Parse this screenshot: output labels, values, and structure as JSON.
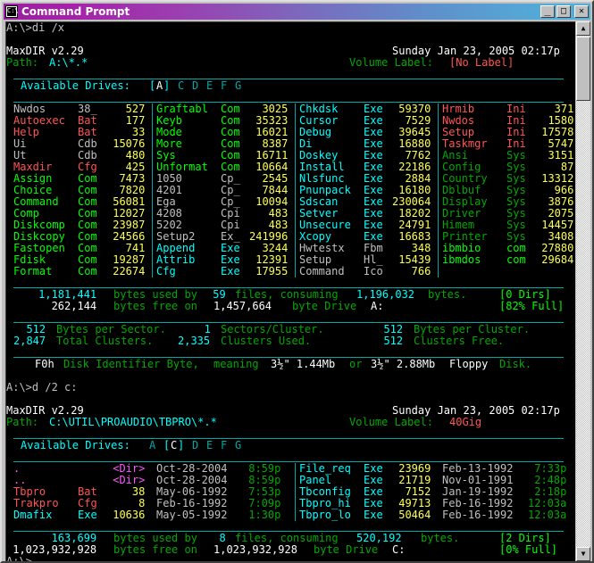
{
  "window": {
    "title": "Command Prompt",
    "icon": "console-window-icon",
    "buttons": {
      "minimize": "_",
      "maximize": "□",
      "close": "✕"
    }
  },
  "scrollbar": {
    "up_arrow": "▲",
    "down_arrow": "▼"
  },
  "console": {
    "prompt1": "A:\\>di /x",
    "prompt2": "A:\\>d /2 c:",
    "prompt3": "A:\\>_",
    "listing1": {
      "app_title": "MaxDIR v2.29",
      "datetime": "Sunday Jan 23, 2005 02:17p",
      "path_label": "Path:",
      "path_value": "A:\\*.*",
      "volume_label": "Volume Label:",
      "volume_value": "[No Label]",
      "drives_label": "Available Drives:",
      "drives_value": "[A] C D E F G",
      "columns": [
        [
          {
            "name": "Nwdos",
            "ext": "38_",
            "size": "527",
            "cname": "c-white",
            "cext": "c-white"
          },
          {
            "name": "Autoexec",
            "ext": "Bat",
            "size": "177",
            "cname": "c-bred",
            "cext": "c-bred"
          },
          {
            "name": "Help",
            "ext": "Bat",
            "size": "33",
            "cname": "c-bred",
            "cext": "c-bred"
          },
          {
            "name": "Ui",
            "ext": "Cdb",
            "size": "15076",
            "cname": "c-white",
            "cext": "c-white"
          },
          {
            "name": "Ut",
            "ext": "Cdb",
            "size": "480",
            "cname": "c-white",
            "cext": "c-white"
          },
          {
            "name": "Maxdir",
            "ext": "Cfg",
            "size": "425",
            "cname": "c-bred",
            "cext": "c-bred"
          },
          {
            "name": "Assign",
            "ext": "Com",
            "size": "7473",
            "cname": "c-bgreen",
            "cext": "c-bgreen"
          },
          {
            "name": "Choice",
            "ext": "Com",
            "size": "7820",
            "cname": "c-bgreen",
            "cext": "c-bgreen"
          },
          {
            "name": "Command",
            "ext": "Com",
            "size": "56081",
            "cname": "c-bgreen",
            "cext": "c-bgreen"
          },
          {
            "name": "Comp",
            "ext": "Com",
            "size": "12027",
            "cname": "c-bgreen",
            "cext": "c-bgreen"
          },
          {
            "name": "Diskcomp",
            "ext": "Com",
            "size": "23987",
            "cname": "c-bgreen",
            "cext": "c-bgreen"
          },
          {
            "name": "Diskcopy",
            "ext": "Com",
            "size": "24566",
            "cname": "c-bgreen",
            "cext": "c-bgreen"
          },
          {
            "name": "Fastopen",
            "ext": "Com",
            "size": "741",
            "cname": "c-bgreen",
            "cext": "c-bgreen"
          },
          {
            "name": "Fdisk",
            "ext": "Com",
            "size": "19287",
            "cname": "c-bgreen",
            "cext": "c-bgreen"
          },
          {
            "name": "Format",
            "ext": "Com",
            "size": "22674",
            "cname": "c-bgreen",
            "cext": "c-bgreen"
          }
        ],
        [
          {
            "name": "Graftabl",
            "ext": "Com",
            "size": "3025",
            "cname": "c-bgreen",
            "cext": "c-bgreen"
          },
          {
            "name": "Keyb",
            "ext": "Com",
            "size": "35323",
            "cname": "c-bgreen",
            "cext": "c-bgreen"
          },
          {
            "name": "Mode",
            "ext": "Com",
            "size": "16021",
            "cname": "c-bgreen",
            "cext": "c-bgreen"
          },
          {
            "name": "More",
            "ext": "Com",
            "size": "8387",
            "cname": "c-bgreen",
            "cext": "c-bgreen"
          },
          {
            "name": "Sys",
            "ext": "Com",
            "size": "16711",
            "cname": "c-bgreen",
            "cext": "c-bgreen"
          },
          {
            "name": "Unformat",
            "ext": "Com",
            "size": "10664",
            "cname": "c-bgreen",
            "cext": "c-bgreen"
          },
          {
            "name": "1050",
            "ext": "Cp_",
            "size": "2545",
            "cname": "c-white",
            "cext": "c-white"
          },
          {
            "name": "4201",
            "ext": "Cp_",
            "size": "7844",
            "cname": "c-white",
            "cext": "c-white"
          },
          {
            "name": "Ega",
            "ext": "Cp_",
            "size": "10094",
            "cname": "c-white",
            "cext": "c-white"
          },
          {
            "name": "4208",
            "ext": "Cpi",
            "size": "483",
            "cname": "c-white",
            "cext": "c-white"
          },
          {
            "name": "5202",
            "ext": "Cpi",
            "size": "483",
            "cname": "c-white",
            "cext": "c-white"
          },
          {
            "name": "Setup2",
            "ext": "Ex_",
            "size": "241996",
            "cname": "c-white",
            "cext": "c-white"
          },
          {
            "name": "Append",
            "ext": "Exe",
            "size": "3244",
            "cname": "c-bcyan",
            "cext": "c-bcyan"
          },
          {
            "name": "Attrib",
            "ext": "Exe",
            "size": "12391",
            "cname": "c-bcyan",
            "cext": "c-bcyan"
          },
          {
            "name": "Cfg",
            "ext": "Exe",
            "size": "17955",
            "cname": "c-bcyan",
            "cext": "c-bcyan"
          }
        ],
        [
          {
            "name": "Chkdsk",
            "ext": "Exe",
            "size": "59370",
            "cname": "c-bcyan",
            "cext": "c-bcyan"
          },
          {
            "name": "Cursor",
            "ext": "Exe",
            "size": "7529",
            "cname": "c-bcyan",
            "cext": "c-bcyan"
          },
          {
            "name": "Debug",
            "ext": "Exe",
            "size": "39645",
            "cname": "c-bcyan",
            "cext": "c-bcyan"
          },
          {
            "name": "Di",
            "ext": "Exe",
            "size": "16880",
            "cname": "c-bcyan",
            "cext": "c-bcyan"
          },
          {
            "name": "Doskey",
            "ext": "Exe",
            "size": "7762",
            "cname": "c-bcyan",
            "cext": "c-bcyan"
          },
          {
            "name": "Install",
            "ext": "Exe",
            "size": "22186",
            "cname": "c-bcyan",
            "cext": "c-bcyan"
          },
          {
            "name": "Nlsfunc",
            "ext": "Exe",
            "size": "2884",
            "cname": "c-bcyan",
            "cext": "c-bcyan"
          },
          {
            "name": "Pnunpack",
            "ext": "Exe",
            "size": "16180",
            "cname": "c-bcyan",
            "cext": "c-bcyan"
          },
          {
            "name": "Sdscan",
            "ext": "Exe",
            "size": "230064",
            "cname": "c-bcyan",
            "cext": "c-bcyan"
          },
          {
            "name": "Setver",
            "ext": "Exe",
            "size": "18202",
            "cname": "c-bcyan",
            "cext": "c-bcyan"
          },
          {
            "name": "Unsecure",
            "ext": "Exe",
            "size": "24791",
            "cname": "c-bcyan",
            "cext": "c-bcyan"
          },
          {
            "name": "Xcopy",
            "ext": "Exe",
            "size": "16683",
            "cname": "c-bcyan",
            "cext": "c-bcyan"
          },
          {
            "name": "Hwtestx",
            "ext": "Fbm",
            "size": "348",
            "cname": "c-white",
            "cext": "c-white"
          },
          {
            "name": "Setup",
            "ext": "Hl_",
            "size": "15439",
            "cname": "c-white",
            "cext": "c-white"
          },
          {
            "name": "Command",
            "ext": "Ico",
            "size": "766",
            "cname": "c-white",
            "cext": "c-white"
          }
        ],
        [
          {
            "name": "Hrmib",
            "ext": "Ini",
            "size": "371",
            "cname": "c-bred",
            "cext": "c-bred"
          },
          {
            "name": "Nwdos",
            "ext": "Ini",
            "size": "1580",
            "cname": "c-bred",
            "cext": "c-bred"
          },
          {
            "name": "Setup",
            "ext": "Ini",
            "size": "17578",
            "cname": "c-bred",
            "cext": "c-bred"
          },
          {
            "name": "Taskmgr",
            "ext": "Ini",
            "size": "5747",
            "cname": "c-bred",
            "cext": "c-bred"
          },
          {
            "name": "Ansi",
            "ext": "Sys",
            "size": "3151",
            "cname": "c-green",
            "cext": "c-green"
          },
          {
            "name": "Config",
            "ext": "Sys",
            "size": "87",
            "cname": "c-green",
            "cext": "c-green"
          },
          {
            "name": "Country",
            "ext": "Sys",
            "size": "13312",
            "cname": "c-green",
            "cext": "c-green"
          },
          {
            "name": "Dblbuf",
            "ext": "Sys",
            "size": "966",
            "cname": "c-green",
            "cext": "c-green"
          },
          {
            "name": "Display",
            "ext": "Sys",
            "size": "3876",
            "cname": "c-green",
            "cext": "c-green"
          },
          {
            "name": "Driver",
            "ext": "Sys",
            "size": "2075",
            "cname": "c-green",
            "cext": "c-green"
          },
          {
            "name": "Himem",
            "ext": "Sys",
            "size": "14457",
            "cname": "c-green",
            "cext": "c-green"
          },
          {
            "name": "Printer",
            "ext": "Sys",
            "size": "3408",
            "cname": "c-green",
            "cext": "c-green"
          },
          {
            "name": "ibmbio",
            "ext": "com",
            "size": "27880",
            "cname": "c-bgreen",
            "cext": "c-bgreen"
          },
          {
            "name": "ibmdos",
            "ext": "com",
            "size": "29684",
            "cname": "c-bgreen",
            "cext": "c-bgreen"
          }
        ]
      ],
      "summary": {
        "bytes_used": "1,181,441",
        "bytes_used_label": "bytes used by",
        "file_count": "59",
        "files_label": "files, consuming",
        "consumed": "1,196,032",
        "bytes_label": "bytes.",
        "dirs": "[0 Dirs]",
        "bytes_free": "262,144",
        "free_label": "bytes free on",
        "total_bytes": "1,457,664",
        "drive_label": "byte Drive",
        "drive": "A:",
        "full": "[82% Full]"
      },
      "geometry": {
        "bytes_per_sector": "512",
        "bytes_per_sector_label": "Bytes per Sector.",
        "sectors_per_cluster": "1",
        "sectors_per_cluster_label": "Sectors/Cluster.",
        "bytes_per_cluster": "512",
        "bytes_per_cluster_label": "Bytes per Cluster.",
        "total_clusters": "2,847",
        "total_clusters_label": "Total Clusters.",
        "clusters_used": "2,335",
        "clusters_used_label": "Clusters Used.",
        "clusters_free": "512",
        "clusters_free_label": "Clusters Free."
      },
      "media": {
        "id_byte": "F0h",
        "id_label": "Disk Identifier Byte,",
        "meaning_label": "meaning",
        "size1": "3½\" 1.44Mb",
        "or_label": "or",
        "size2": "3½\" 2.88Mb",
        "media_label": "Floppy",
        "disk_label": "Disk."
      }
    },
    "listing2": {
      "app_title": "MaxDIR v2.29",
      "datetime": "Sunday Jan 23, 2005 02:17p",
      "path_label": "Path:",
      "path_value": "C:\\UTIL\\PROAUDIO\\TBPRO\\*.*",
      "volume_label": "Volume Label:",
      "volume_value": "40Gig",
      "drives_label": "Available Drives:",
      "drives_value": "A [C] D E F G",
      "columns": [
        [
          {
            "name": ".",
            "ext": "",
            "size": "<Dir>",
            "date": "Oct-28-2004",
            "time": "8:59p",
            "cname": "c-magenta",
            "cext": "c-magenta",
            "csize": "c-magenta"
          },
          {
            "name": "..",
            "ext": "",
            "size": "<Dir>",
            "date": "Oct-28-2004",
            "time": "8:59p",
            "cname": "c-magenta",
            "cext": "c-magenta",
            "csize": "c-magenta"
          },
          {
            "name": "Tbpro",
            "ext": "Bat",
            "size": "38",
            "date": "May-06-1992",
            "time": "7:53p",
            "cname": "c-bred",
            "cext": "c-bred",
            "csize": "c-yellow"
          },
          {
            "name": "Trakpro",
            "ext": "Cfg",
            "size": "8",
            "date": "Feb-16-1992",
            "time": "7:09p",
            "cname": "c-bred",
            "cext": "c-bred",
            "csize": "c-yellow"
          },
          {
            "name": "Dmafix",
            "ext": "Exe",
            "size": "10636",
            "date": "May-05-1992",
            "time": "1:30p",
            "cname": "c-bcyan",
            "cext": "c-bcyan",
            "csize": "c-yellow"
          }
        ],
        [
          {
            "name": "File_req",
            "ext": "Exe",
            "size": "23969",
            "date": "Feb-13-1992",
            "time": "7:33p",
            "cname": "c-bcyan",
            "cext": "c-bcyan",
            "csize": "c-yellow"
          },
          {
            "name": "Panel",
            "ext": "Exe",
            "size": "21719",
            "date": "Nov-01-1991",
            "time": "2:48p",
            "cname": "c-bcyan",
            "cext": "c-bcyan",
            "csize": "c-yellow"
          },
          {
            "name": "Tbconfig",
            "ext": "Exe",
            "size": "7152",
            "date": "Jan-19-1992",
            "time": "2:18p",
            "cname": "c-bcyan",
            "cext": "c-bcyan",
            "csize": "c-yellow"
          },
          {
            "name": "Tbpro_hi",
            "ext": "Exe",
            "size": "49713",
            "date": "Feb-16-1992",
            "time": "12:03a",
            "cname": "c-bcyan",
            "cext": "c-bcyan",
            "csize": "c-yellow"
          },
          {
            "name": "Tbpro_lo",
            "ext": "Exe",
            "size": "50464",
            "date": "Feb-16-1992",
            "time": "12:03a",
            "cname": "c-bcyan",
            "cext": "c-bcyan",
            "csize": "c-yellow"
          }
        ]
      ],
      "summary": {
        "bytes_used": "163,699",
        "bytes_used_label": "bytes used by",
        "file_count": "8",
        "files_label": "files, consuming",
        "consumed": "520,192",
        "bytes_label": "bytes.",
        "dirs": "[2 Dirs]",
        "bytes_free": "1,023,932,928",
        "free_label": "bytes free on",
        "total_bytes": "1,023,932,928",
        "drive_label": "byte Drive",
        "drive": "C:",
        "full": "[0% Full]"
      }
    }
  },
  "colors": {
    "background": "#000000",
    "separator": "#00a8a8",
    "title_left": "#9a1fa0",
    "title_right": "#51b0d8",
    "face": "#c0c0c0"
  }
}
